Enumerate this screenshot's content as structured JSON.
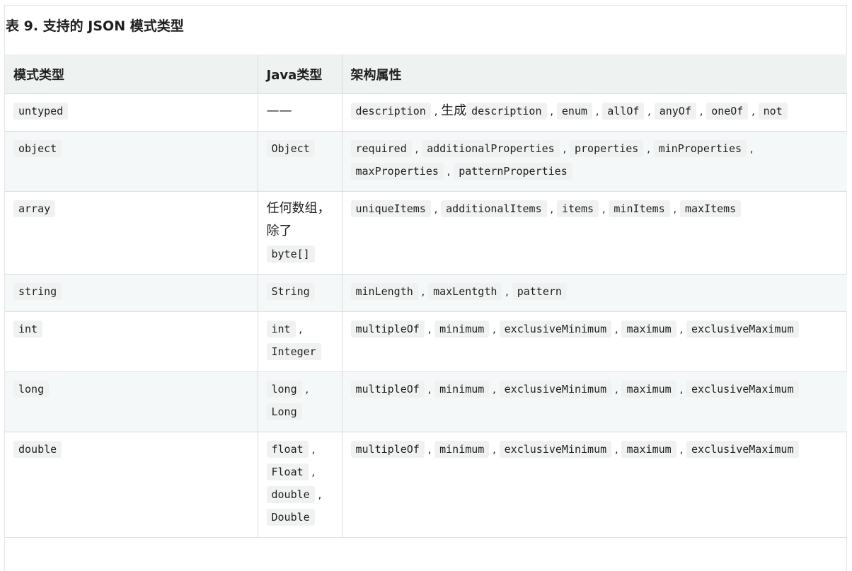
{
  "caption": "表 9. 支持的 JSON 模式类型",
  "headers": [
    "模式类型",
    "Java类型",
    "架构属性"
  ],
  "rows": [
    {
      "schema": "untyped",
      "java": [
        {
          "t": "text",
          "v": "——"
        }
      ],
      "props": [
        {
          "t": "code",
          "v": "description"
        },
        {
          "t": "sep",
          "v": " , "
        },
        {
          "t": "text",
          "v": "生成"
        },
        {
          "t": "code",
          "v": "description"
        },
        {
          "t": "sep",
          "v": " , "
        },
        {
          "t": "code",
          "v": "enum"
        },
        {
          "t": "sep",
          "v": " , "
        },
        {
          "t": "code",
          "v": "allOf"
        },
        {
          "t": "sep",
          "v": " , "
        },
        {
          "t": "code",
          "v": "anyOf"
        },
        {
          "t": "sep",
          "v": " , "
        },
        {
          "t": "code",
          "v": "oneOf"
        },
        {
          "t": "sep",
          "v": " , "
        },
        {
          "t": "code",
          "v": "not"
        }
      ]
    },
    {
      "schema": "object",
      "java": [
        {
          "t": "code",
          "v": "Object"
        }
      ],
      "props": [
        {
          "t": "code",
          "v": "required"
        },
        {
          "t": "sep",
          "v": " , "
        },
        {
          "t": "code",
          "v": "additionalProperties"
        },
        {
          "t": "sep",
          "v": " , "
        },
        {
          "t": "code",
          "v": "properties"
        },
        {
          "t": "sep",
          "v": " , "
        },
        {
          "t": "code",
          "v": "minProperties"
        },
        {
          "t": "sep",
          "v": " , "
        },
        {
          "t": "code",
          "v": "maxProperties"
        },
        {
          "t": "sep",
          "v": " , "
        },
        {
          "t": "code",
          "v": "patternProperties"
        }
      ]
    },
    {
      "schema": "array",
      "java": [
        {
          "t": "text",
          "v": "任何数组，除了"
        },
        {
          "t": "code",
          "v": "byte[]"
        }
      ],
      "props": [
        {
          "t": "code",
          "v": "uniqueItems"
        },
        {
          "t": "sep",
          "v": " , "
        },
        {
          "t": "code",
          "v": "additionalItems"
        },
        {
          "t": "sep",
          "v": " , "
        },
        {
          "t": "code",
          "v": "items"
        },
        {
          "t": "sep",
          "v": " , "
        },
        {
          "t": "code",
          "v": "minItems"
        },
        {
          "t": "sep",
          "v": " , "
        },
        {
          "t": "code",
          "v": "maxItems"
        }
      ]
    },
    {
      "schema": "string",
      "java": [
        {
          "t": "code",
          "v": "String"
        }
      ],
      "props": [
        {
          "t": "code",
          "v": "minLength"
        },
        {
          "t": "sep",
          "v": " , "
        },
        {
          "t": "code",
          "v": "maxLentgth"
        },
        {
          "t": "sep",
          "v": " , "
        },
        {
          "t": "code",
          "v": "pattern"
        }
      ]
    },
    {
      "schema": "int",
      "java": [
        {
          "t": "code",
          "v": "int"
        },
        {
          "t": "sep",
          "v": " , "
        },
        {
          "t": "code",
          "v": "Integer"
        }
      ],
      "props": [
        {
          "t": "code",
          "v": "multipleOf"
        },
        {
          "t": "sep",
          "v": " , "
        },
        {
          "t": "code",
          "v": "minimum"
        },
        {
          "t": "sep",
          "v": " , "
        },
        {
          "t": "code",
          "v": "exclusiveMinimum"
        },
        {
          "t": "sep",
          "v": " , "
        },
        {
          "t": "code",
          "v": "maximum"
        },
        {
          "t": "sep",
          "v": " , "
        },
        {
          "t": "code",
          "v": "exclusiveMaximum"
        }
      ]
    },
    {
      "schema": "long",
      "java": [
        {
          "t": "code",
          "v": "long"
        },
        {
          "t": "sep",
          "v": " , "
        },
        {
          "t": "code",
          "v": "Long"
        }
      ],
      "props": [
        {
          "t": "code",
          "v": "multipleOf"
        },
        {
          "t": "sep",
          "v": " , "
        },
        {
          "t": "code",
          "v": "minimum"
        },
        {
          "t": "sep",
          "v": " , "
        },
        {
          "t": "code",
          "v": "exclusiveMinimum"
        },
        {
          "t": "sep",
          "v": " , "
        },
        {
          "t": "code",
          "v": "maximum"
        },
        {
          "t": "sep",
          "v": " , "
        },
        {
          "t": "code",
          "v": "exclusiveMaximum"
        }
      ]
    },
    {
      "schema": "double",
      "java": [
        {
          "t": "code",
          "v": "float"
        },
        {
          "t": "sep",
          "v": " , "
        },
        {
          "t": "code",
          "v": "Float"
        },
        {
          "t": "sep",
          "v": " , "
        },
        {
          "t": "code",
          "v": "double"
        },
        {
          "t": "sep",
          "v": " , "
        },
        {
          "t": "code",
          "v": "Double"
        }
      ],
      "props": [
        {
          "t": "code",
          "v": "multipleOf"
        },
        {
          "t": "sep",
          "v": " , "
        },
        {
          "t": "code",
          "v": "minimum"
        },
        {
          "t": "sep",
          "v": " , "
        },
        {
          "t": "code",
          "v": "exclusiveMinimum"
        },
        {
          "t": "sep",
          "v": " , "
        },
        {
          "t": "code",
          "v": "maximum"
        },
        {
          "t": "sep",
          "v": " , "
        },
        {
          "t": "code",
          "v": "exclusiveMaximum"
        }
      ]
    }
  ]
}
